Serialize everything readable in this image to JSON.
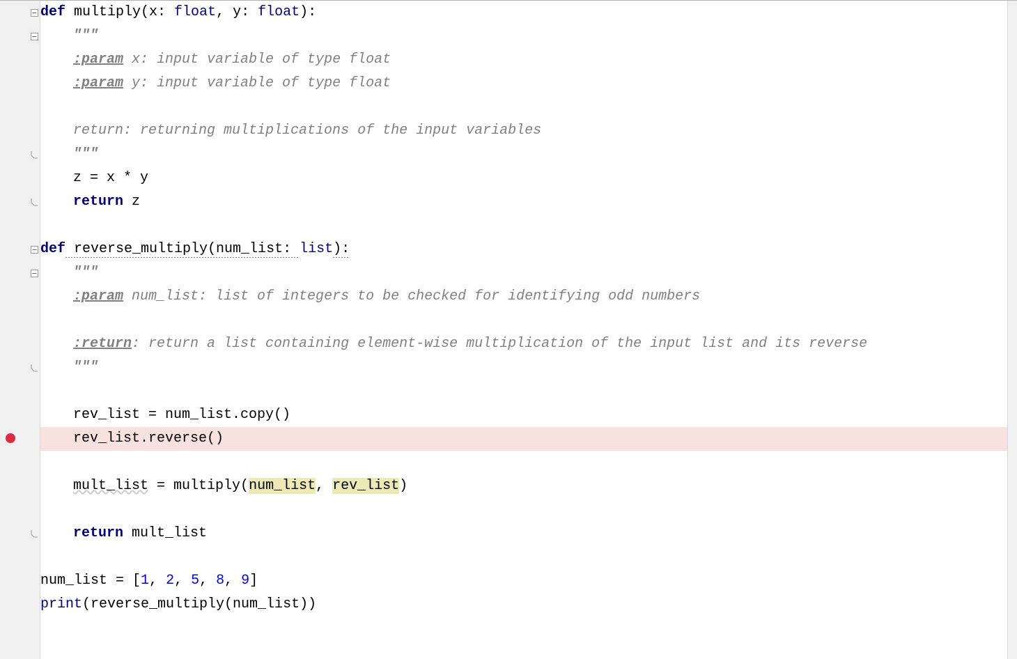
{
  "code": {
    "line1": {
      "def": "def",
      "fn": " multiply(x: ",
      "t1": "float",
      "mid": ", y: ",
      "t2": "float",
      "end": "):"
    },
    "line2": "\"\"\"",
    "line3": {
      "tag": ":param",
      "rest": " x: input variable of type float"
    },
    "line4": {
      "tag": ":param",
      "rest": " y: input variable of type float"
    },
    "line5": "return: returning multiplications of the input variables",
    "line6": "\"\"\"",
    "line7": "z = x * y",
    "line8": {
      "ret": "return",
      "rest": " z"
    },
    "line9": {
      "def": "def",
      "fn": " reverse_multiply(num_list: ",
      "t1": "list",
      "end": "):"
    },
    "line10": "\"\"\"",
    "line11": {
      "tag": ":param",
      "rest": " num_list: list of integers to be checked for identifying odd numbers"
    },
    "line12": {
      "tag": ":return",
      "rest": ": return a list containing element-wise multiplication of the input list and its reverse"
    },
    "line13": "\"\"\"",
    "line14": "rev_list = num_list.copy()",
    "line15": "rev_list.reverse()",
    "line16": {
      "a": "mult_list",
      "b": " = multiply(",
      "c": "num_list",
      "d": ", ",
      "e": "rev_list",
      "f": ")"
    },
    "line17": {
      "ret": "return",
      "rest": " mult_list"
    },
    "line18": {
      "a": "num_list = [",
      "n1": "1",
      "s": ", ",
      "n2": "2",
      "n3": "5",
      "n4": "8",
      "n5": "9",
      "b": "]"
    },
    "line19": {
      "a": "print",
      "b": "(reverse_multiply(num_list))"
    }
  },
  "gutter": {
    "breakpoint_line": 18
  }
}
